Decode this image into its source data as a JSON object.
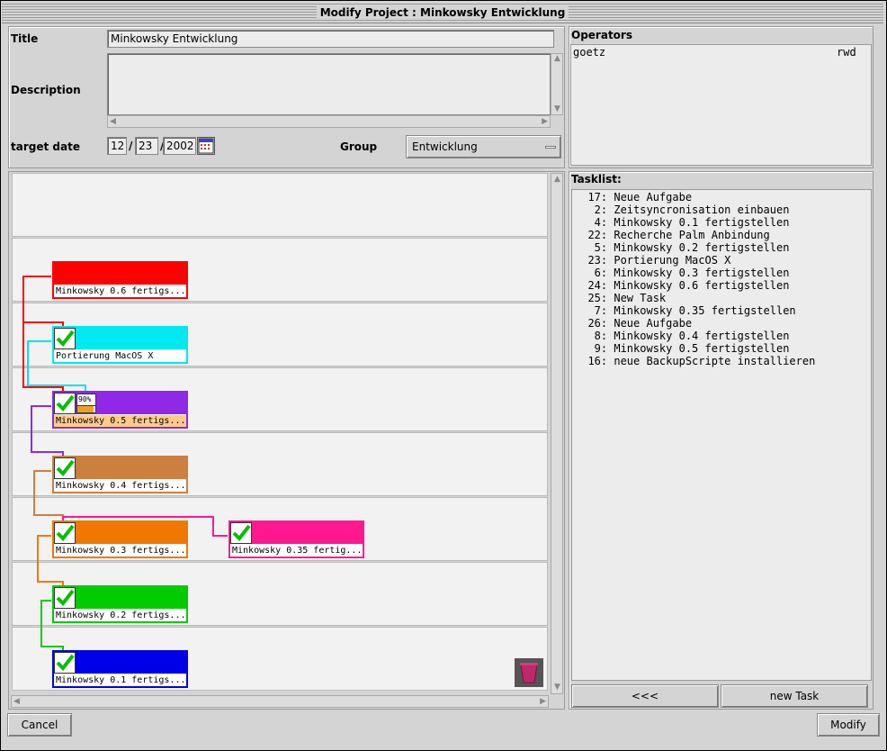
{
  "window": {
    "title": "Modify Project : Minkowsky Entwicklung"
  },
  "form": {
    "title_label": "Title",
    "title_value": "Minkowsky Entwicklung",
    "description_label": "Description",
    "description_value": "",
    "target_date_label": "target date",
    "date_month": "12",
    "date_day": "23",
    "date_year": "2002",
    "date_sep": "/",
    "group_label": "Group",
    "group_value": "Entwicklung"
  },
  "operators": {
    "header": "Operators",
    "rows": [
      {
        "name": "goetz",
        "rights": "rwd"
      }
    ]
  },
  "tasklist": {
    "header": "Tasklist:",
    "items": [
      "  17: Neue Aufgabe",
      "   2: Zeitsyncronisation einbauen",
      "   4: Minkowsky 0.1 fertigstellen",
      "  22: Recherche Palm Anbindung",
      "   5: Minkowsky 0.2 fertigstellen",
      "  23: Portierung MacOS X",
      "   6: Minkowsky 0.3 fertigstellen",
      "  24: Minkowsky 0.6 fertigstellen",
      "  25: New Task",
      "   7: Minkowsky 0.35 fertigstellen",
      "  26: Neue Aufgabe",
      "   8: Minkowsky 0.4 fertigstellen",
      "   9: Minkowsky 0.5 fertigstellen",
      "  16: neue BackupScripte installieren"
    ],
    "back_button": "<<<",
    "new_task_button": "new Task"
  },
  "diagram": {
    "tasks": [
      {
        "label": "Minkowsky 0.6 fertigs...",
        "color": "#ff0000",
        "done": false,
        "progress_label": "",
        "progress": null
      },
      {
        "label": "Portierung MacOS X",
        "color": "#00e8f0",
        "done": true,
        "progress_label": "",
        "progress": null
      },
      {
        "label": "Minkowsky 0.5 fertigs...",
        "color": "#9028e8",
        "done": true,
        "progress_label": "90%",
        "progress": 0.9
      },
      {
        "label": "Minkowsky 0.4 fertigs...",
        "color": "#cc8040",
        "done": true,
        "progress_label": "",
        "progress": null
      },
      {
        "label": "Minkowsky 0.3 fertigs...",
        "color": "#f07800",
        "done": true,
        "progress_label": "",
        "progress": null
      },
      {
        "label": "Minkowsky 0.35 fertig...",
        "color": "#ff1890",
        "done": true,
        "progress_label": "",
        "progress": null
      },
      {
        "label": "Minkowsky 0.2 fertigs...",
        "color": "#00cc00",
        "done": true,
        "progress_label": "",
        "progress": null
      },
      {
        "label": "Minkowsky 0.1 fertigs...",
        "color": "#0000e8",
        "done": true,
        "progress_label": "",
        "progress": null
      }
    ]
  },
  "footer": {
    "cancel_button": "Cancel",
    "modify_button": "Modify"
  }
}
